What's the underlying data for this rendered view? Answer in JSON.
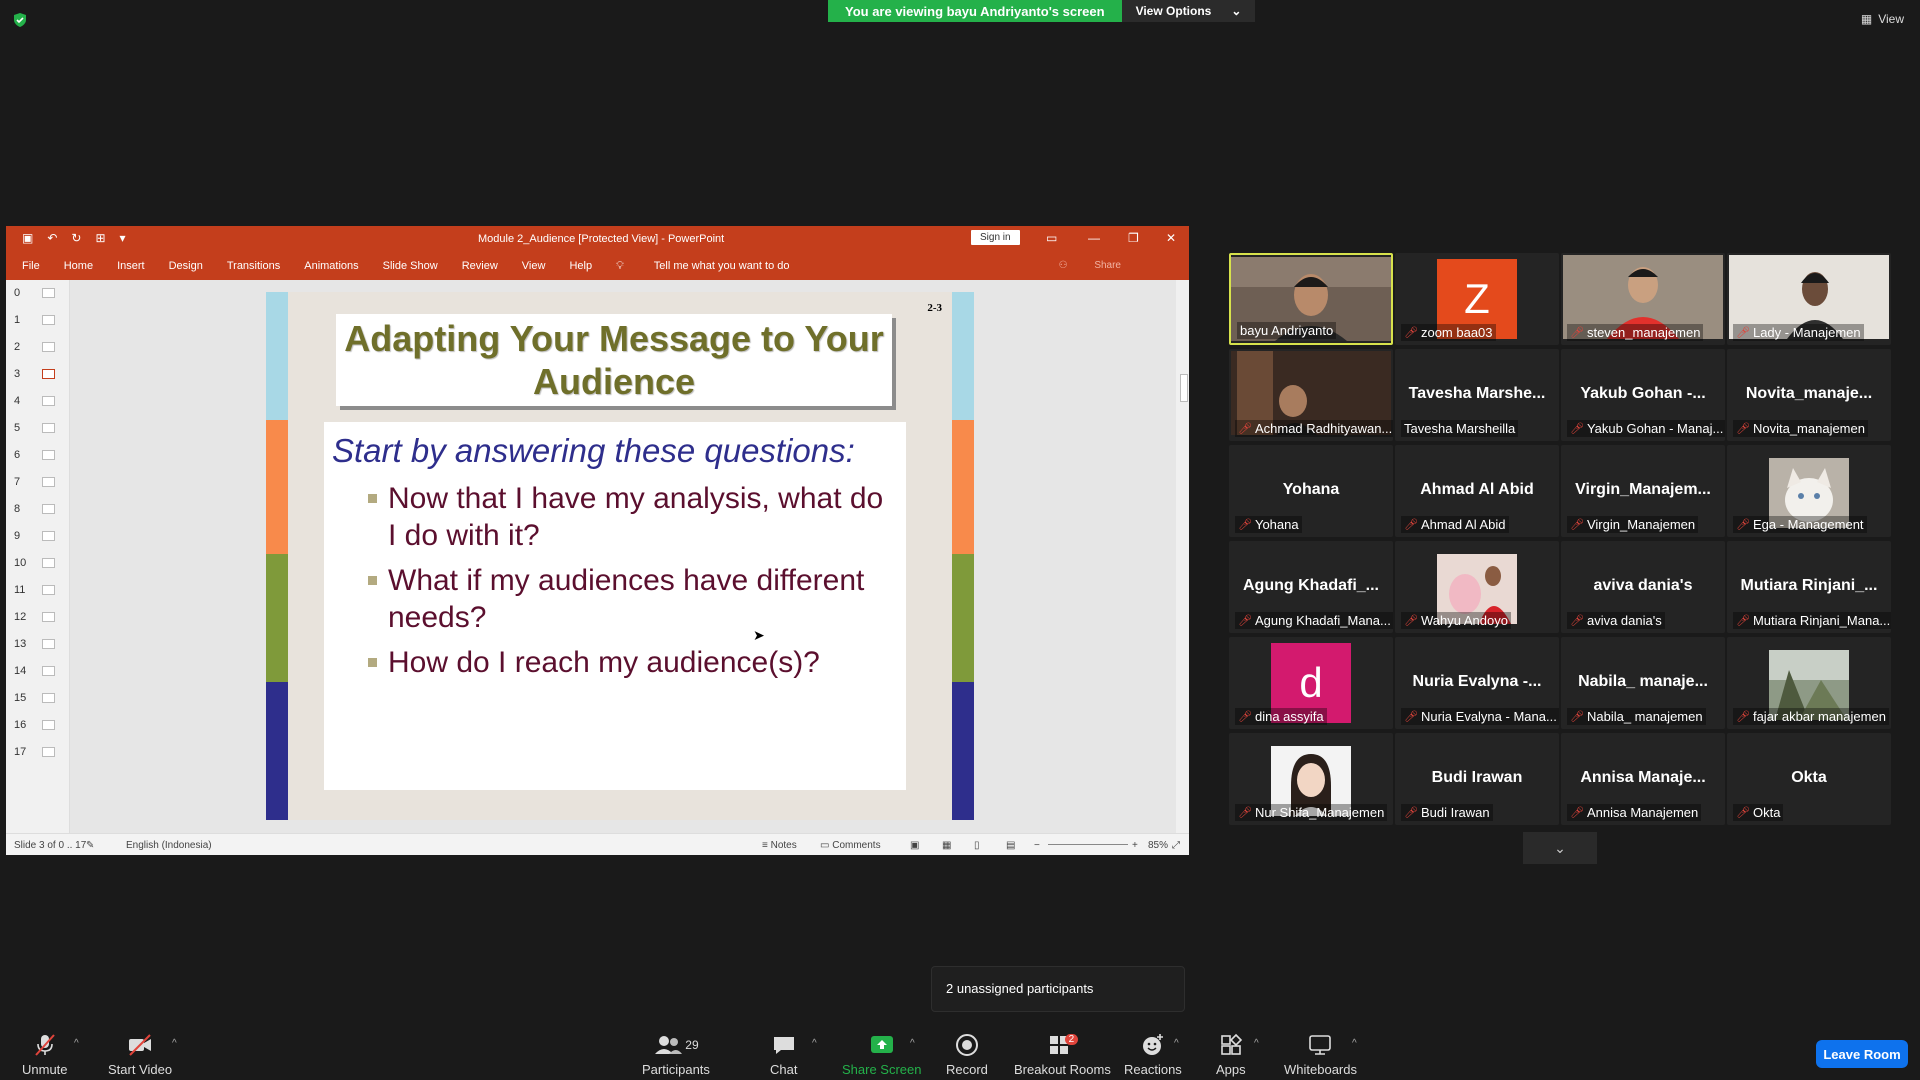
{
  "banner": {
    "viewing": "You are viewing bayu Andriyanto's screen",
    "view_options": "View Options"
  },
  "top_view": "View",
  "ppt": {
    "window_title": "Module 2_Audience [Protected View]  -  PowerPoint",
    "sign_in": "Sign in",
    "ribbon": [
      "File",
      "Home",
      "Insert",
      "Design",
      "Transitions",
      "Animations",
      "Slide Show",
      "Review",
      "View",
      "Help"
    ],
    "tell_me": "Tell me what you want to do",
    "share": "Share",
    "thumb_numbers": [
      "0",
      "1",
      "2",
      "3",
      "4",
      "5",
      "6",
      "7",
      "8",
      "9",
      "10",
      "11",
      "12",
      "13",
      "14",
      "15",
      "16",
      "17"
    ],
    "status": {
      "slide": "Slide 3 of 0 .. 17",
      "language": "English (Indonesia)",
      "notes": "Notes",
      "comments": "Comments",
      "zoom": "85%"
    }
  },
  "slide": {
    "number": "2-3",
    "title": "Adapting Your Message to Your Audience",
    "subtitle": "Start by answering these questions:",
    "bullets": [
      "Now that I have my analysis, what do I do with it?",
      "What if my audiences have different needs?",
      "How do I reach my audience(s)?"
    ]
  },
  "tiles": [
    {
      "name": "bayu Andriyanto",
      "center": "",
      "kind": "video",
      "active": true
    },
    {
      "name": "zoom baa03",
      "center": "",
      "kind": "avatar",
      "letter": "Z",
      "color": "#e44a1c"
    },
    {
      "name": "steven_manajemen",
      "center": "",
      "kind": "video"
    },
    {
      "name": "Lady - Manajemen",
      "center": "",
      "kind": "video"
    },
    {
      "name": "Achmad Radhityawan...",
      "center": "",
      "kind": "video"
    },
    {
      "name": "Tavesha Marsheilla",
      "center": "Tavesha  Marshe...",
      "kind": "text",
      "nomic": true
    },
    {
      "name": "Yakub Gohan - Manaj...",
      "center": "Yakub Gohan -...",
      "kind": "text"
    },
    {
      "name": "Novita_manajemen",
      "center": "Novita_manaje...",
      "kind": "text"
    },
    {
      "name": "Yohana",
      "center": "Yohana",
      "kind": "text"
    },
    {
      "name": "Ahmad Al Abid",
      "center": "Ahmad Al Abid",
      "kind": "text"
    },
    {
      "name": "Virgin_Manajemen",
      "center": "Virgin_Manajem...",
      "kind": "text"
    },
    {
      "name": "Ega - Management",
      "center": "",
      "kind": "photo-cat"
    },
    {
      "name": "Agung Khadafi_Mana...",
      "center": "Agung  Khadafi_...",
      "kind": "text"
    },
    {
      "name": "Wahyu Andoyo",
      "center": "",
      "kind": "photo-flowers"
    },
    {
      "name": "aviva dania's",
      "center": "aviva dania's",
      "kind": "text"
    },
    {
      "name": "Mutiara Rinjani_Mana...",
      "center": "Mutiara  Rinjani_...",
      "kind": "text"
    },
    {
      "name": "dina assyifa",
      "center": "",
      "kind": "avatar",
      "letter": "d",
      "color": "#d31a6e"
    },
    {
      "name": "Nuria Evalyna - Mana...",
      "center": "Nuria Evalyna -...",
      "kind": "text"
    },
    {
      "name": "Nabila_ manajemen",
      "center": "Nabila_  manaje...",
      "kind": "text"
    },
    {
      "name": "fajar akbar manajemen",
      "center": "",
      "kind": "photo-tree"
    },
    {
      "name": "Nur Shifa_Manajemen",
      "center": "",
      "kind": "photo-girl"
    },
    {
      "name": "Budi Irawan",
      "center": "Budi Irawan",
      "kind": "text"
    },
    {
      "name": "Annisa Manajemen",
      "center": "Annisa  Manaje...",
      "kind": "text"
    },
    {
      "name": "Okta",
      "center": "Okta",
      "kind": "text"
    }
  ],
  "popup": "2 unassigned participants",
  "toolbar": {
    "unmute": "Unmute",
    "start_video": "Start Video",
    "participants": "Participants",
    "participants_count": "29",
    "chat": "Chat",
    "share_screen": "Share Screen",
    "record": "Record",
    "breakout_rooms": "Breakout Rooms",
    "breakout_badge": "2",
    "reactions": "Reactions",
    "apps": "Apps",
    "whiteboards": "Whiteboards",
    "leave_room": "Leave Room"
  },
  "colors": {
    "zoom_green": "#24b14a",
    "ppt_red": "#c43e1c",
    "leave_blue": "#0e72ed",
    "active_tile": "#d7e24c"
  }
}
